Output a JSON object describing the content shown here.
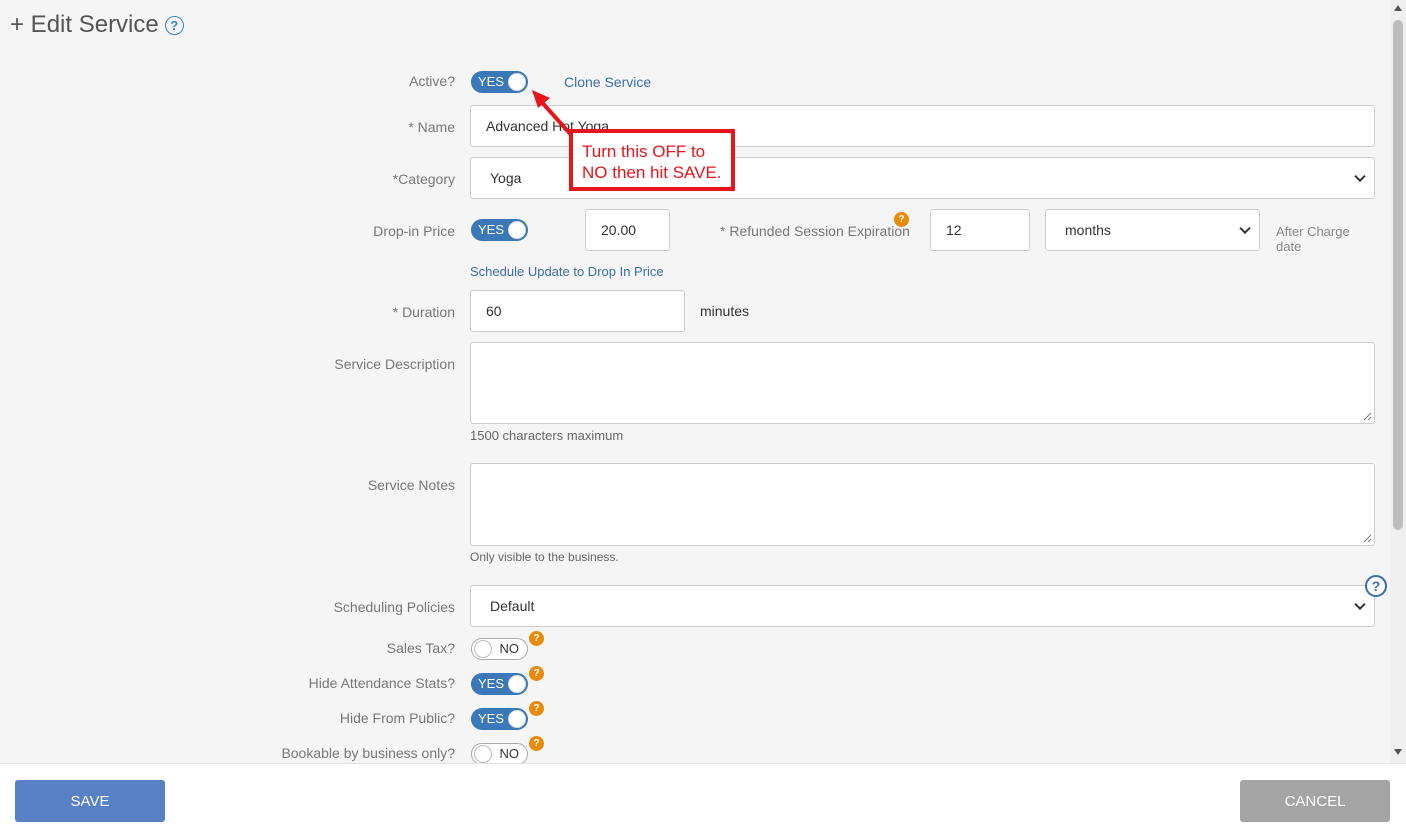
{
  "header": {
    "title": "+ Edit Service",
    "help_glyph": "?"
  },
  "active": {
    "label": "Active?",
    "toggle": "YES",
    "clone_link": "Clone Service"
  },
  "name": {
    "label": "* Name",
    "value": "Advanced Hot Yoga"
  },
  "annotation": {
    "line1": "Turn this OFF to",
    "line2": "NO then hit SAVE.",
    "color": "#e8141b"
  },
  "category": {
    "label": "*Category",
    "value": "Yoga"
  },
  "dropin": {
    "label": "Drop-in Price",
    "toggle": "YES",
    "price": "20.00",
    "refund_label": "* Refunded Session Expiration",
    "refund_value": "12",
    "refund_unit": "months",
    "after_line1": "After Charge",
    "after_line2": "date",
    "schedule_link": "Schedule Update to Drop In Price"
  },
  "duration": {
    "label": "* Duration",
    "value": "60",
    "unit": "minutes"
  },
  "description": {
    "label": "Service Description",
    "hint": "1500 characters maximum"
  },
  "notes": {
    "label": "Service Notes",
    "hint": "Only visible to the business."
  },
  "policies": {
    "label": "Scheduling Policies",
    "value": "Default"
  },
  "toggles": [
    {
      "label": "Sales Tax?",
      "value": "NO"
    },
    {
      "label": "Hide Attendance Stats?",
      "value": "YES"
    },
    {
      "label": "Hide From Public?",
      "value": "YES"
    },
    {
      "label": "Bookable by business only?",
      "value": "NO"
    }
  ],
  "badge_glyph": "?",
  "footer": {
    "save": "SAVE",
    "cancel": "CANCEL"
  },
  "colors": {
    "primary": "#3a78b8",
    "save": "#5781c4",
    "cancel": "#a4a4a4",
    "badge": "#e88a0c"
  }
}
